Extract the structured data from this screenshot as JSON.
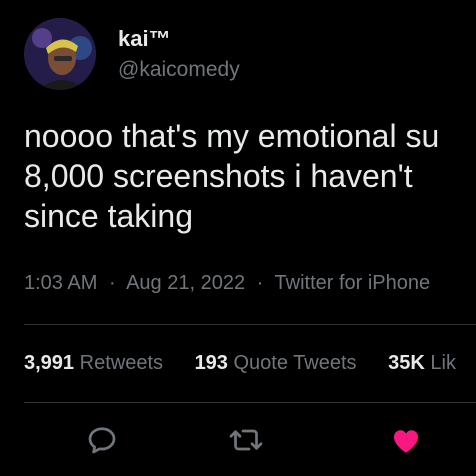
{
  "author": {
    "display_name": "kai™",
    "handle": "@kaicomedy"
  },
  "tweet": {
    "text": "noooo that's my emotional su\n8,000 screenshots i haven't\nsince taking"
  },
  "meta": {
    "time": "1:03 AM",
    "date": "Aug 21, 2022",
    "source": "Twitter for iPhone",
    "separator": "·"
  },
  "stats": {
    "retweets": {
      "count": "3,991",
      "label": "Retweets"
    },
    "quotes": {
      "count": "193",
      "label": "Quote Tweets"
    },
    "likes": {
      "count": "35K",
      "label": "Lik"
    }
  },
  "actions": {
    "reply_icon": "reply-bubble-icon",
    "retweet_icon": "retweet-arrows-icon",
    "like_icon": "heart-filled-icon"
  },
  "colors": {
    "background": "#000000",
    "primary_text": "#e7e9ea",
    "secondary_text": "#71767b",
    "like_active": "#f91880",
    "divider": "#2f3336"
  }
}
